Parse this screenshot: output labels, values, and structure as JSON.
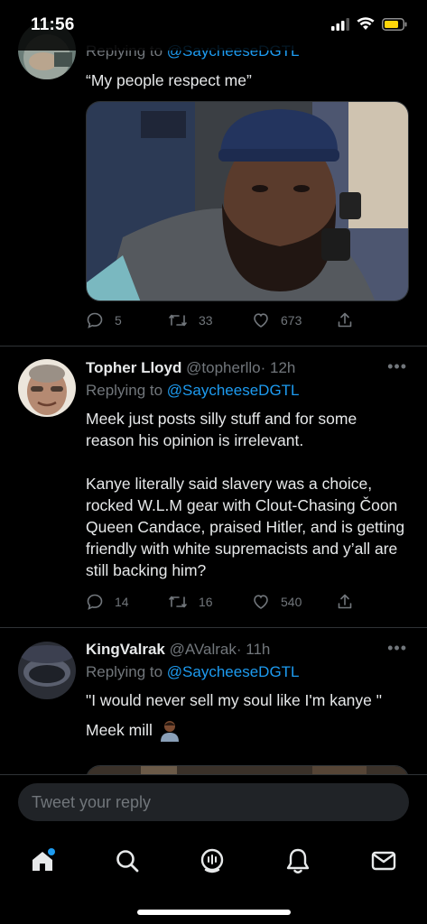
{
  "status": {
    "time": "11:56"
  },
  "tweets": [
    {
      "reply_prefix": "Replying to",
      "reply_mention": "@SaycheeseDGTL",
      "text": "“My people respect me”",
      "stats": {
        "replies": "5",
        "retweets": "33",
        "likes": "673"
      }
    },
    {
      "name": "Topher Lloyd",
      "handle": "@topherllo",
      "time": "· 12h",
      "reply_prefix": "Replying to",
      "reply_mention": "@SaycheeseDGTL",
      "text_p1": "Meek just posts silly stuff and for some reason his opinion is irrelevant.",
      "text_p2": "Kanye literally said slavery was a choice, rocked W.L.M gear with Clout-Chasing Čoon Queen Candace, praised Hitler, and is getting friendly with white supremacists and y’all are still backing him?",
      "stats": {
        "replies": "14",
        "retweets": "16",
        "likes": "540"
      }
    },
    {
      "name": "KingValrak",
      "handle": "@AValrak",
      "time": "· 11h",
      "reply_prefix": "Replying to",
      "reply_mention": "@SaycheeseDGTL",
      "text_p1": "\"I would  never sell my soul like I'm kanye \"",
      "text_p2": "Meek mill"
    }
  ],
  "composer": {
    "placeholder": "Tweet your reply"
  },
  "tabs": [
    "home-icon",
    "search-icon",
    "spaces-icon",
    "notifications-icon",
    "messages-icon"
  ],
  "colors": {
    "accent": "#1d9bf0",
    "muted": "#71767b",
    "text": "#e7e9ea",
    "background": "#000000"
  }
}
